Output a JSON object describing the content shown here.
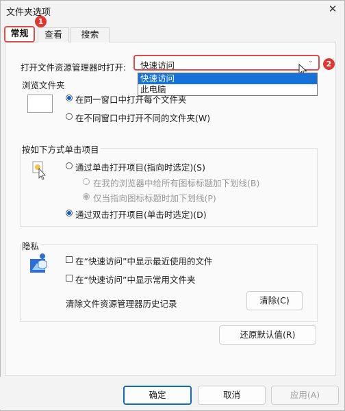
{
  "window": {
    "title": "文件夹选项",
    "close_glyph": "✕"
  },
  "tabs": [
    {
      "label": "常规",
      "active": true
    },
    {
      "label": "查看",
      "active": false
    },
    {
      "label": "搜索",
      "active": false
    }
  ],
  "annotations": {
    "badge1": "1",
    "badge2": "2",
    "badge_color": "#e0362f"
  },
  "open_with": {
    "label": "打开文件资源管理器时打开:",
    "selected": "快速访问",
    "options": [
      "快速访问",
      "此电脑"
    ]
  },
  "browse_folders": {
    "title": "浏览文件夹",
    "options": [
      {
        "label": "在同一窗口中打开每个文件夹",
        "selected": true
      },
      {
        "label": "在不同窗口中打开不同的文件夹(W)",
        "selected": false
      }
    ]
  },
  "click_items": {
    "title": "按如下方式单击项目",
    "single_click": "通过单击打开项目(指向时选定)(S)",
    "underline_browser": "在我的浏览器中给所有图标标题加下划线(B)",
    "underline_point": "仅当指向图标标题时加下划线(P)",
    "double_click": "通过双击打开项目(单击时选定)(D)"
  },
  "privacy": {
    "title": "隐私",
    "show_recent": "在“快速访问”中显示最近使用的文件",
    "show_frequent": "在“快速访问”中显示常用文件夹",
    "clear_label": "清除文件资源管理器历史记录",
    "clear_button": "清除(C)"
  },
  "restore_defaults": "还原默认值(R)",
  "footer": {
    "ok": "确定",
    "cancel": "取消",
    "apply": "应用(A)"
  },
  "colors": {
    "accent": "#0f6cbd",
    "highlight": "#1671d8",
    "annotation": "#e24b45"
  }
}
